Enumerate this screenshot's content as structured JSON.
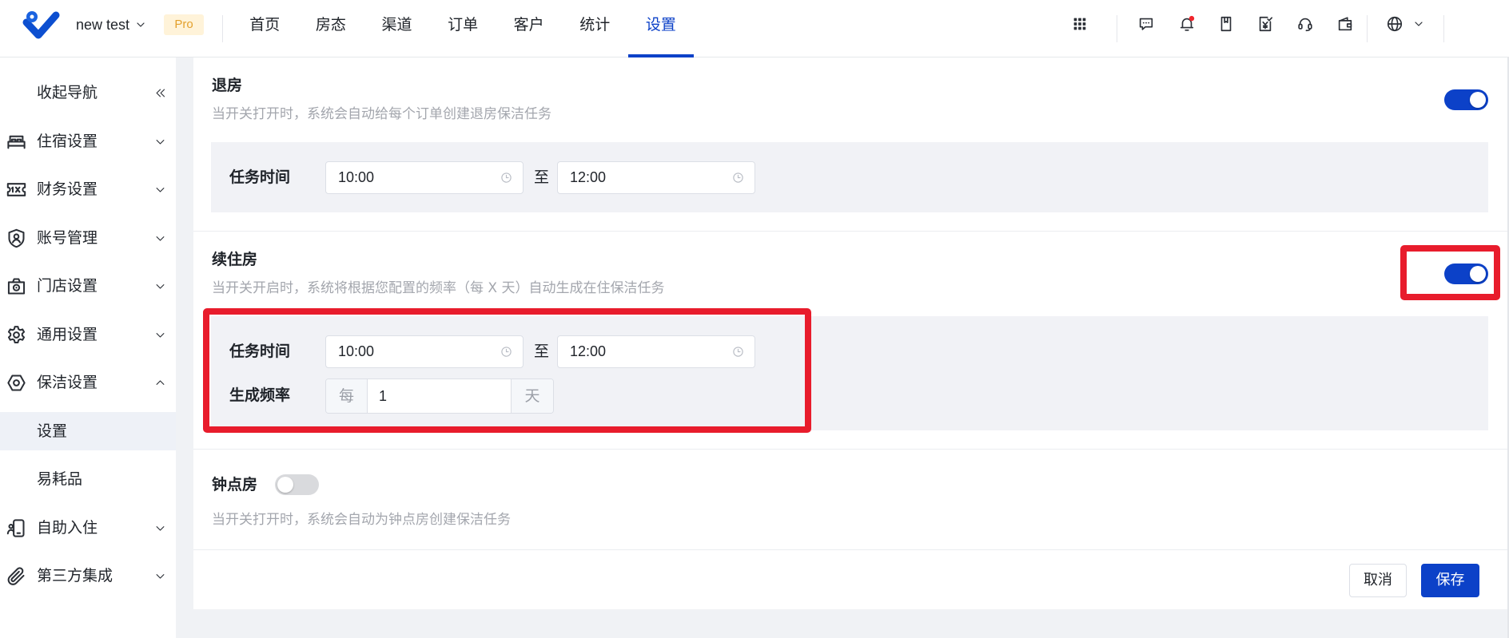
{
  "header": {
    "brand": {
      "name": "new test",
      "badge": "Pro",
      "logo_icon": "brand-logo-icon"
    },
    "nav": [
      {
        "label": "首页",
        "active": false
      },
      {
        "label": "房态",
        "active": false
      },
      {
        "label": "渠道",
        "active": false
      },
      {
        "label": "订单",
        "active": false
      },
      {
        "label": "客户",
        "active": false
      },
      {
        "label": "统计",
        "active": false
      },
      {
        "label": "设置",
        "active": true
      }
    ],
    "toolbar_icons": [
      "apps-grid-icon",
      "message-icon",
      "notification-bell-icon",
      "book-icon",
      "invoice-icon",
      "customer-service-icon",
      "wallet-icon",
      "language-globe-icon"
    ],
    "has_unread_notification": true
  },
  "sidebar": {
    "collapse_label": "收起导航",
    "items": [
      {
        "label": "住宿设置",
        "icon": "bed-icon",
        "expanded": false
      },
      {
        "label": "财务设置",
        "icon": "finance-icon",
        "expanded": false
      },
      {
        "label": "账号管理",
        "icon": "account-shield-icon",
        "expanded": false
      },
      {
        "label": "门店设置",
        "icon": "store-icon",
        "expanded": false
      },
      {
        "label": "通用设置",
        "icon": "gear-icon",
        "expanded": false
      },
      {
        "label": "保洁设置",
        "icon": "cleaning-icon",
        "expanded": true,
        "children": [
          {
            "label": "设置",
            "active": true
          },
          {
            "label": "易耗品",
            "active": false
          }
        ]
      },
      {
        "label": "自助入住",
        "icon": "self-checkin-icon",
        "expanded": false
      },
      {
        "label": "第三方集成",
        "icon": "paperclip-icon",
        "expanded": false
      }
    ]
  },
  "sections": [
    {
      "title": "退房",
      "description": "当开关打开时，系统会自动给每个订单创建退房保洁任务",
      "enabled": true,
      "task_time": {
        "label": "任务时间",
        "start": "10:00",
        "separator": "至",
        "end": "12:00"
      }
    },
    {
      "title": "续住房",
      "description": "当开关开启时，系统将根据您配置的频率（每 X 天）自动生成在住保洁任务",
      "enabled": true,
      "task_time": {
        "label": "任务时间",
        "start": "10:00",
        "separator": "至",
        "end": "12:00"
      },
      "frequency": {
        "label": "生成频率",
        "prefix": "每",
        "value": "1",
        "suffix": "天"
      }
    },
    {
      "title": "钟点房",
      "description": "当开关打开时，系统会自动为钟点房创建保洁任务",
      "enabled": false
    }
  ],
  "footer": {
    "cancel_label": "取消",
    "save_label": "保存"
  },
  "colors": {
    "primary": "#0c41c8",
    "annotation_highlight": "#e81c2c",
    "panel_background": "#f1f2f6",
    "sidebar_active_background": "#eef1f7"
  }
}
